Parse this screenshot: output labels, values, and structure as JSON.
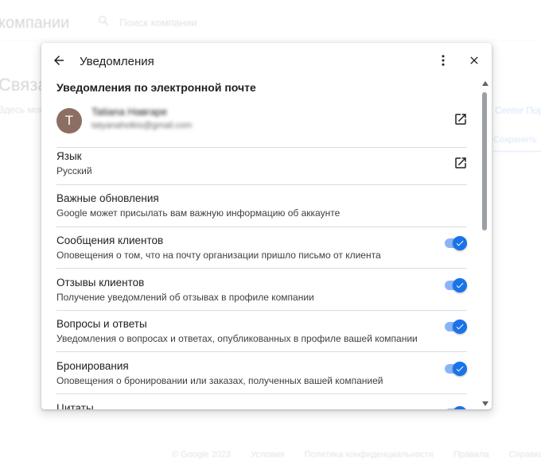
{
  "background": {
    "title": "компании",
    "search_placeholder": "Поиск компании",
    "heading": "Связаться",
    "subtitle": "Здесь можно",
    "right_link_1": "Center Пор",
    "right_link_2": "Сохранить",
    "footer": [
      "© Google 2023",
      "Условия",
      "Политика конфиденциальности",
      "Правила",
      "Справка"
    ]
  },
  "dialog": {
    "title": "Уведомления",
    "section_title": "Уведомления по электронной почте",
    "account": {
      "avatar_letter": "T",
      "name": "Tatiana Навгаре",
      "email": "tatyanahotkis@gmail.com",
      "avatar_color": "#8d6e63"
    },
    "language": {
      "title": "Язык",
      "value": "Русский"
    },
    "important": {
      "title": "Важные обновления",
      "desc": "Google может присылать вам важную информацию об аккаунте"
    },
    "items": [
      {
        "title": "Сообщения клиентов",
        "desc": "Оповещения о том, что на почту организации пришло письмо от клиента",
        "enabled": true
      },
      {
        "title": "Отзывы клиентов",
        "desc": "Получение уведомлений об отзывах в профиле компании",
        "enabled": true
      },
      {
        "title": "Вопросы и ответы",
        "desc": "Уведомления о вопросах и ответах, опубликованных в профиле вашей компании",
        "enabled": true
      },
      {
        "title": "Бронирования",
        "desc": "Оповещения о бронировании или заказах, полученных вашей компанией",
        "enabled": true
      },
      {
        "title": "Цитаты",
        "desc": "",
        "enabled": true
      }
    ]
  },
  "colors": {
    "accent": "#1a73e8",
    "track": "#8ab4f8",
    "divider": "#dadce0"
  }
}
